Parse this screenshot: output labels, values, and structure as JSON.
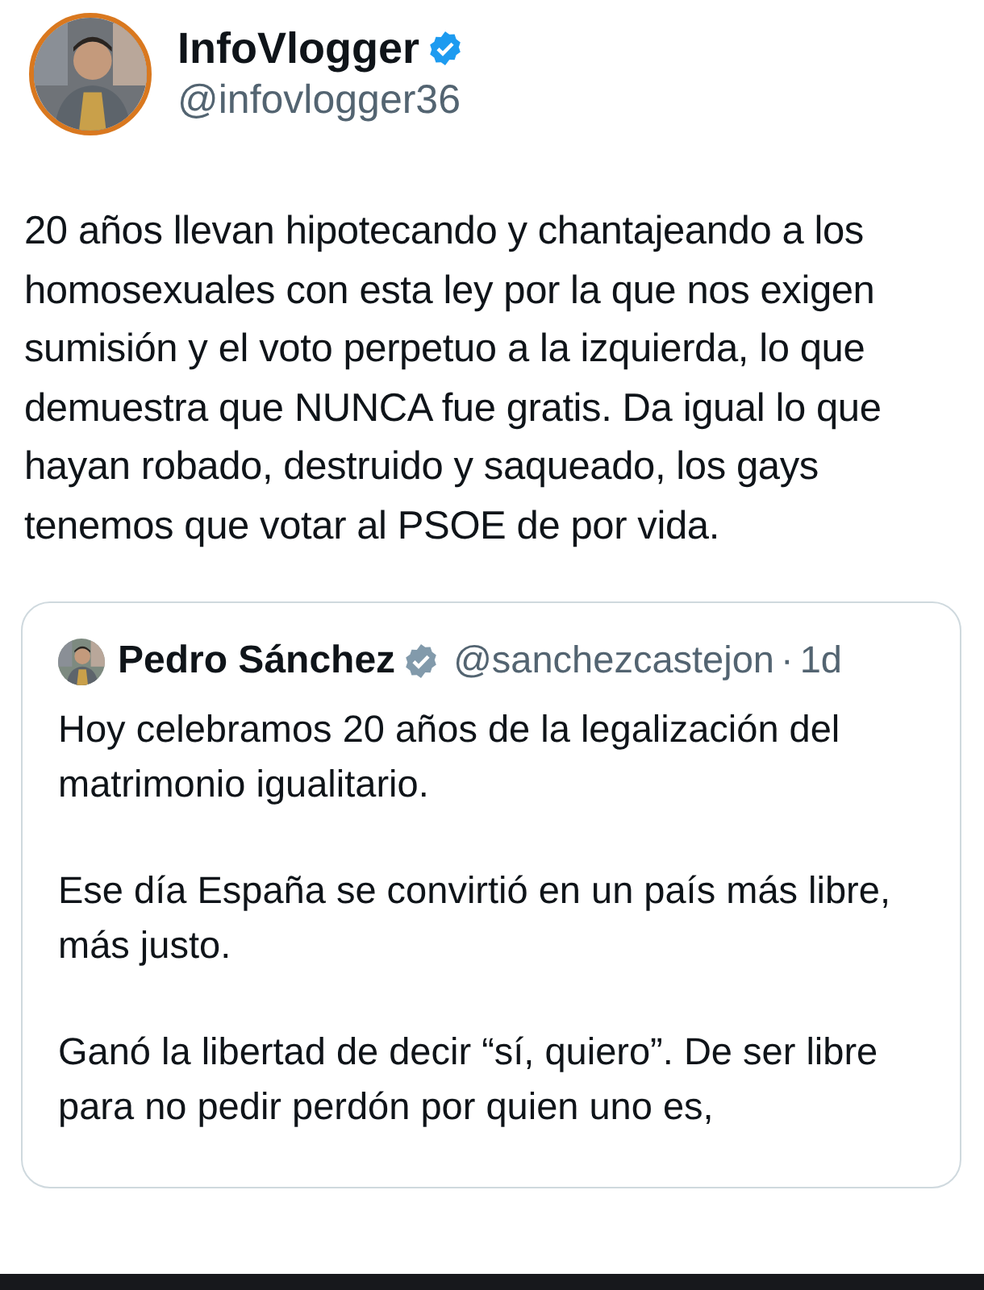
{
  "author": {
    "name": "InfoVlogger",
    "verified": true,
    "handle": "@infovlogger36"
  },
  "text": "20 años llevan hipotecando y chantajeando a los homosexuales con esta ley por la que nos exigen sumisión y el voto perpetuo a la izquierda, lo que demuestra que NUNCA fue gratis. Da igual lo que hayan robado, destruido y saqueado, los gays tenemos que votar al PSOE de por vida.",
  "quote": {
    "name": "Pedro Sánchez",
    "verified": true,
    "handle": "@sanchezcastejon",
    "separator": "·",
    "time": "1d",
    "paragraphs": [
      "Hoy celebramos 20 años de la legalización del matrimonio igualitario.",
      "Ese día España se convirtió en un país más libre, más justo.",
      "Ganó la libertad de decir “sí, quiero”. De ser libre para no pedir perdón por quien uno es,"
    ]
  }
}
